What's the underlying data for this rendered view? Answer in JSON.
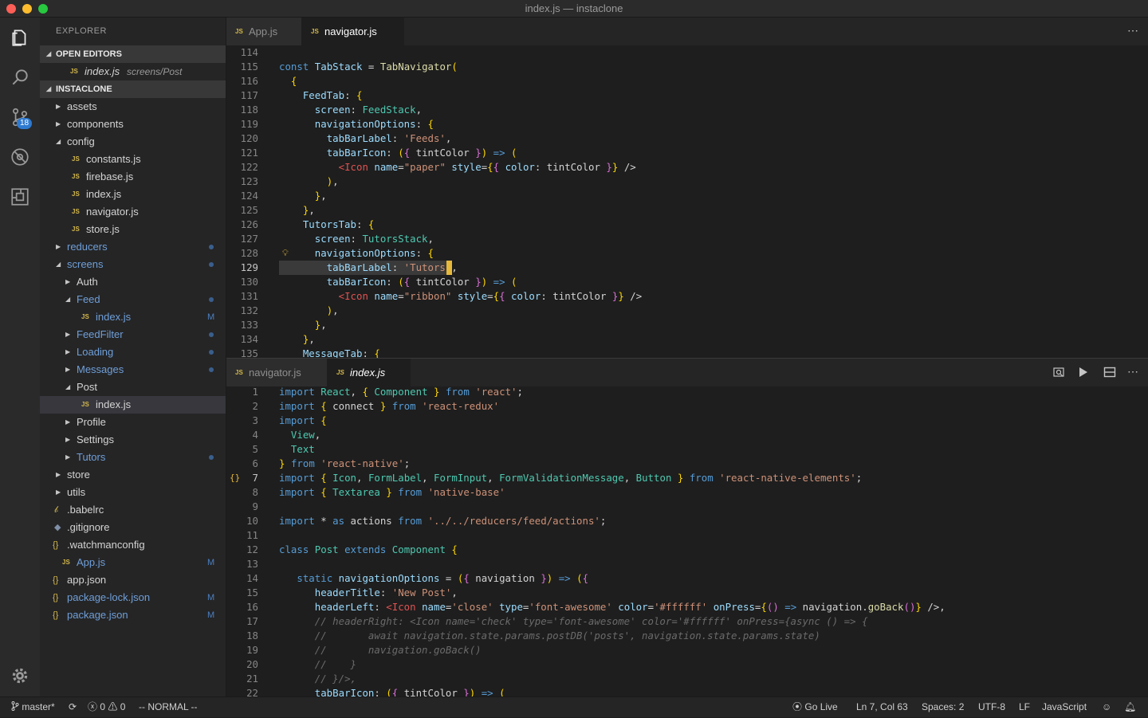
{
  "window": {
    "title": "index.js — instaclone"
  },
  "activity_bar": {
    "scm_badge": "18"
  },
  "explorer": {
    "title": "EXPLORER",
    "open_editors_label": "OPEN EDITORS",
    "open_editor": {
      "name": "index.js",
      "hint": "screens/Post"
    },
    "project_label": "INSTACLONE",
    "tree": [
      {
        "label": "assets"
      },
      {
        "label": "components"
      },
      {
        "label": "config"
      },
      {
        "label": "constants.js"
      },
      {
        "label": "firebase.js"
      },
      {
        "label": "index.js"
      },
      {
        "label": "navigator.js"
      },
      {
        "label": "store.js"
      },
      {
        "label": "reducers"
      },
      {
        "label": "screens"
      },
      {
        "label": "Auth"
      },
      {
        "label": "Feed"
      },
      {
        "label": "index.js",
        "status": "M"
      },
      {
        "label": "FeedFilter"
      },
      {
        "label": "Loading"
      },
      {
        "label": "Messages"
      },
      {
        "label": "Post"
      },
      {
        "label": "index.js"
      },
      {
        "label": "Profile"
      },
      {
        "label": "Settings"
      },
      {
        "label": "Tutors"
      },
      {
        "label": "store"
      },
      {
        "label": "utils"
      },
      {
        "label": ".babelrc"
      },
      {
        "label": ".gitignore"
      },
      {
        "label": ".watchmanconfig"
      },
      {
        "label": "App.js",
        "status": "M"
      },
      {
        "label": "app.json"
      },
      {
        "label": "package-lock.json",
        "status": "M"
      },
      {
        "label": "package.json",
        "status": "M"
      }
    ]
  },
  "top_editor": {
    "tabs": [
      {
        "label": "App.js"
      },
      {
        "label": "navigator.js"
      }
    ],
    "line_numbers": [
      "114",
      "115",
      "116",
      "117",
      "118",
      "119",
      "120",
      "121",
      "122",
      "123",
      "124",
      "125",
      "126",
      "127",
      "128",
      "129",
      "130",
      "131",
      "132",
      "133",
      "134",
      "135"
    ],
    "lines": [
      "",
      "const TabStack = TabNavigator(",
      "  {",
      "    FeedTab: {",
      "      screen: FeedStack,",
      "      navigationOptions: {",
      "        tabBarLabel: 'Feeds',",
      "        tabBarIcon: ({ tintColor }) => (",
      "          <Icon name=\"paper\" style={{ color: tintColor }} />",
      "        ),",
      "      },",
      "    },",
      "    TutorsTab: {",
      "      screen: TutorsStack,",
      "      navigationOptions: {",
      "        tabBarLabel: 'Tutors',",
      "        tabBarIcon: ({ tintColor }) => (",
      "          <Icon name=\"ribbon\" style={{ color: tintColor }} />",
      "        ),",
      "      },",
      "    },",
      "    MessageTab: {"
    ]
  },
  "bottom_editor": {
    "tabs": [
      {
        "label": "navigator.js"
      },
      {
        "label": "index.js"
      }
    ],
    "line_numbers": [
      "1",
      "2",
      "3",
      "4",
      "5",
      "6",
      "7",
      "8",
      "9",
      "10",
      "11",
      "12",
      "13",
      "14",
      "15",
      "16",
      "17",
      "18",
      "19",
      "20",
      "21",
      "22"
    ],
    "lines": [
      "import React, { Component } from 'react';",
      "import { connect } from 'react-redux'",
      "import {",
      "  View,",
      "  Text",
      "} from 'react-native';",
      "import { Icon, FormLabel, FormInput, FormValidationMessage, Button } from 'react-native-elements';",
      "import { Textarea } from 'native-base'",
      "",
      "import * as actions from '../../reducers/feed/actions';",
      "",
      "class Post extends Component {",
      "",
      "   static navigationOptions = ({ navigation }) => ({",
      "      headerTitle: 'New Post',",
      "      headerLeft: <Icon name='close' type='font-awesome' color='#ffffff' onPress={() => navigation.goBack()} />,",
      "      // headerRight: <Icon name='check' type='font-awesome' color='#ffffff' onPress={async () => {",
      "      //       await navigation.state.params.postDB('posts', navigation.state.params.state)",
      "      //       navigation.goBack()",
      "      //    }",
      "      // }/>,",
      "      tabBarIcon: ({ tintColor }) => ("
    ]
  },
  "status_bar": {
    "branch": "master*",
    "errors": "0",
    "warnings": "0",
    "mode": "-- NORMAL --",
    "go_live": "Go Live",
    "position": "Ln 7, Col 63",
    "spaces": "Spaces: 2",
    "encoding": "UTF-8",
    "eol": "LF",
    "language": "JavaScript"
  },
  "colors": {
    "statusbar_bg": "#252526",
    "accent_blue": "#2e7ad1",
    "cursor": "#e6b83c"
  }
}
